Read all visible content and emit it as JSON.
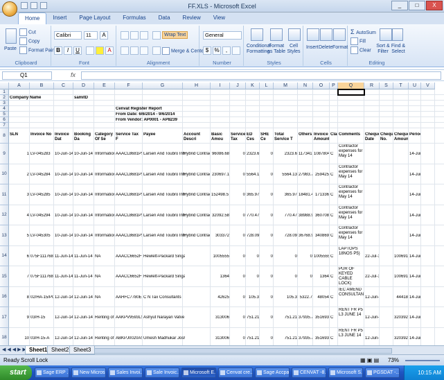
{
  "window": {
    "title": "FF.XLS - Microsoft Excel",
    "min": "_",
    "max": "□",
    "close": "X"
  },
  "tabs": [
    "Home",
    "Insert",
    "Page Layout",
    "Formulas",
    "Data",
    "Review",
    "View"
  ],
  "ribbon": {
    "clipboard": {
      "paste": "Paste",
      "cut": "Cut",
      "copy": "Copy",
      "format_painter": "Format Painter",
      "label": "Clipboard"
    },
    "font": {
      "name": "Calibri",
      "size": "11",
      "bold": "B",
      "italic": "I",
      "underline": "U",
      "grow": "A",
      "label": "Font"
    },
    "alignment": {
      "wrap": "Wrap Text",
      "merge": "Merge & Center",
      "label": "Alignment"
    },
    "number": {
      "format": "General",
      "currency": "$",
      "percent": "%",
      "comma": ",",
      "label": "Number"
    },
    "styles": {
      "conditional": "Conditional Formatting",
      "format_table": "Format as Table",
      "cell_styles": "Cell Styles",
      "label": "Styles"
    },
    "cells": {
      "insert": "Insert",
      "delete": "Delete",
      "format": "Format",
      "label": "Cells"
    },
    "editing": {
      "autosum": "AutoSum",
      "fill": "Fill",
      "clear": "Clear",
      "sort": "Sort & Filter",
      "find": "Find & Select",
      "label": "Editing"
    }
  },
  "formula_bar": {
    "name_box": "Q1",
    "fx": "fx",
    "value": ""
  },
  "columns": [
    "A",
    "B",
    "C",
    "D",
    "E",
    "F",
    "G",
    "H",
    "I",
    "J",
    "K",
    "L",
    "M",
    "N",
    "O",
    "P",
    "Q",
    "R",
    "S",
    "T",
    "U",
    "V"
  ],
  "rows_visible": [
    "1",
    "2",
    "3",
    "4",
    "5",
    "6",
    "7",
    "8",
    "9",
    "10",
    "11",
    "12",
    "13",
    "14",
    "15",
    "16",
    "17",
    "18"
  ],
  "sheet": {
    "company_label": "Company Name",
    "company_value": "samitD",
    "report_title": "Cenvat Register Report",
    "from_date": "From Date: 6/6/2014 - 9/6/2014",
    "from_vendor": "From Vendor: AP0001 - AP8239",
    "headers": [
      "SLN",
      "Invoice No",
      "Invoice Dat",
      "Booking Da",
      "Category Of Se",
      "Service Tax F",
      "Payee",
      "Account Descri",
      "Basic Amou",
      "Service Tax",
      "ED Ces",
      "SHE Ce",
      "Total Service T",
      "Others",
      "Invoice Amount",
      "Claima",
      "Comments",
      "Cheque Date",
      "Cheque No.",
      "Cheque Amount",
      "Period"
    ],
    "rows": [
      {
        "row": "9",
        "sln": "1",
        "inv": "LV-045283",
        "inv_date": "10-Jun-14",
        "book_date": "10-Jun-14",
        "cat": "Information Techn",
        "stax": "AAACL8681PSC",
        "payee": "Larsen And Toubro Infi",
        "acct": "Hybrid Contractor E",
        "basic": "96086.68",
        "st": "0",
        "edc": "2323.6",
        "shec": "0",
        "tst": "2323.6",
        "others": "11734172",
        "inv_amt": "1087804",
        "claim": "C",
        "comments": "Contractor expenses for May 14",
        "cdate": "",
        "cno": "",
        "camt": "",
        "period": "14-Jun"
      },
      {
        "row": "10",
        "sln": "2",
        "inv": "LV-045284",
        "inv_date": "10-Jun-14",
        "book_date": "10-Jun-14",
        "cat": "Information Techn",
        "stax": "AAACL8681PSC",
        "payee": "Larsen And Toubro Infi",
        "acct": "Hybrid Contractor E",
        "basic": "230697.1",
        "st": "0",
        "edc": "5564.13",
        "shec": "0",
        "tst": "5564.13",
        "others": "27983.77",
        "inv_amt": "259425",
        "claim": "C",
        "comments": "Contractor expenses for May 14",
        "cdate": "",
        "cno": "",
        "camt": "",
        "period": "14-Jun"
      },
      {
        "row": "11",
        "sln": "3",
        "inv": "LV-045285",
        "inv_date": "10-Jun-14",
        "book_date": "10-Jun-14",
        "cat": "Information Techn",
        "stax": "AAACL8681PSC",
        "payee": "Larsen And Toubro Infi",
        "acct": "Hybrid Contractor E",
        "basic": "152498.57",
        "st": "0",
        "edc": "365.97",
        "shec": "0",
        "tst": "365.97",
        "others": "18481.46",
        "inv_amt": "171336",
        "claim": "C",
        "comments": "Contractor expenses for May 14",
        "cdate": "",
        "cno": "",
        "camt": "",
        "period": "14-Jun"
      },
      {
        "row": "12",
        "sln": "4",
        "inv": "LV-045294",
        "inv_date": "10-Jun-14",
        "book_date": "10-Jun-14",
        "cat": "Information Techn",
        "stax": "AAACL8681PSC",
        "payee": "Larsen And Toubro Infi",
        "acct": "Hybrid Contractor E",
        "basic": "32092.58",
        "st": "0",
        "edc": "770.47",
        "shec": "0",
        "tst": "770.47",
        "others": "38988.95",
        "inv_amt": "360708",
        "claim": "C",
        "comments": "Contractor expenses for May 14",
        "cdate": "",
        "cno": "",
        "camt": "",
        "period": "14-Jun"
      },
      {
        "row": "13",
        "sln": "5",
        "inv": "LV-045305",
        "inv_date": "10-Jun-14",
        "book_date": "10-Jun-14",
        "cat": "Information Techn",
        "stax": "AAACL8681PSC",
        "payee": "Larsen And Toubro Infi",
        "acct": "Hybrid Contractor E",
        "basic": "303372",
        "st": "0",
        "edc": "728.09",
        "shec": "0",
        "tst": "728.09",
        "others": "36768.91",
        "inv_amt": "340869",
        "claim": "C",
        "comments": "Contractor expenses for May 14",
        "cdate": "",
        "cno": "",
        "camt": "",
        "period": "14-Jun"
      },
      {
        "row": "14",
        "sln": "6",
        "inv": "075F1117680",
        "inv_date": "11-Jun-14",
        "book_date": "11-Jun-14",
        "cat": "NA",
        "stax": "AAACC6652FS",
        "payee": "Hewlett-Packard Singapore (Sales) Pte Ltd",
        "acct": "",
        "basic": "1005555",
        "st": "0",
        "edc": "0",
        "shec": "0",
        "tst": "0",
        "others": "0",
        "inv_amt": "1005555",
        "claim": "C",
        "comments": "LAPTOPS 18NOS P5)",
        "cdate": "22-Jul-14",
        "cno": "",
        "camt": "1006919",
        "period": "14-Jun"
      },
      {
        "row": "15",
        "sln": "7",
        "inv": "075F1117680",
        "inv_date": "11-Jun-14",
        "book_date": "11-Jun-14",
        "cat": "NA",
        "stax": "AAACC6652FS",
        "payee": "Hewlett-Packard Singapore (Sales) Pte Ltd",
        "acct": "",
        "basic": "1364",
        "st": "0",
        "edc": "0",
        "shec": "0",
        "tst": "0",
        "others": "0",
        "inv_amt": "1364",
        "claim": "C",
        "comments": "PUR OF KEYED CABLE LOCK)",
        "cdate": "22-Jul-14",
        "cno": "",
        "camt": "1006919",
        "period": "14-Jun"
      },
      {
        "row": "16",
        "sln": "8",
        "inv": "02/HA-15/PGS",
        "inv_date": "12-Jun-14",
        "book_date": "12-Jun-14",
        "cat": "NA",
        "stax": "AAHFC7780ESC",
        "payee": "C N Tax Consultants",
        "acct": "",
        "basic": "42625",
        "st": "0",
        "edc": "105.3",
        "shec": "0",
        "tst": "105.3",
        "others": "5322.7",
        "inv_amt": "48054",
        "claim": "C",
        "comments": "IEC AMEND CONSULTANCY",
        "cdate": "12-Jun-14",
        "cno": "",
        "camt": "44418",
        "period": "14-Jun"
      },
      {
        "row": "17",
        "sln": "9",
        "inv": "03/H-15",
        "inv_date": "12-Jun-14",
        "book_date": "12-Jun-14",
        "cat": "Renting of Immov",
        "stax": "AAKPV9593LS",
        "payee": "Ashyut Narayan Vatve",
        "acct": "",
        "basic": "313006",
        "st": "0",
        "edc": "751.21",
        "shec": "0",
        "tst": "751.21",
        "others": "37935.79",
        "inv_amt": "351693",
        "claim": "C",
        "comments": "RENT FR P5 L3 JUNE 14",
        "cdate": "12-Jun-14",
        "cno": "",
        "camt": "320392",
        "period": "14-Jun"
      },
      {
        "row": "18",
        "sln": "10",
        "inv": "03/H-15-A",
        "inv_date": "12-Jun-14",
        "book_date": "12-Jun-14",
        "cat": "Renting of Immov",
        "stax": "ABKPJ0020AS",
        "payee": "Umesh Madhukar Joshi",
        "acct": "",
        "basic": "313006",
        "st": "0",
        "edc": "751.21",
        "shec": "0",
        "tst": "751.21",
        "others": "37935.79",
        "inv_amt": "351693",
        "claim": "C",
        "comments": "RENT FR P5 L3 JUNE 14",
        "cdate": "12-Jun-14",
        "cno": "",
        "camt": "320392",
        "period": "14-Jun"
      }
    ]
  },
  "sheet_tabs": [
    "Sheet1",
    "Sheet2",
    "Sheet3"
  ],
  "status": {
    "ready": "Ready",
    "scroll_lock": "Scroll Lock",
    "zoom": "73%"
  },
  "taskbar": {
    "start": "start",
    "tasks": [
      "Sage ERP ...",
      "New Micros...",
      "Sales Invoi...",
      "Sale Invoic...",
      "Microsoft E...",
      "Cenvat cre...",
      "Sage Accpac",
      "CENVAT -8...",
      "Microsoft S...",
      "PGSDAT -..."
    ],
    "clock": "10:15 AM"
  },
  "colors": {
    "selected_column_highlight": "#f9d49a",
    "taskbar_blue": "#1f56c2",
    "start_green": "#2f8a2a"
  }
}
